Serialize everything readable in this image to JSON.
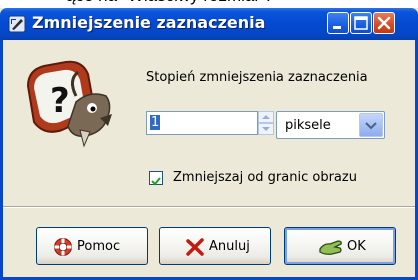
{
  "background_text": "ące na \"Właściwy rozmiar\".",
  "window": {
    "title": "Zmniejszenie zaznaczenia",
    "title_icon": "shrink-selection-icon"
  },
  "title_buttons": {
    "minimize": "minimize-icon",
    "maximize": "maximize-icon",
    "close": "close-icon"
  },
  "dialog": {
    "icon": "gimp-help-icon",
    "shrink_label": "Stopień zmniejszenia zaznaczenia",
    "shrink_value": "1",
    "unit": "piksele",
    "shrink_from_border_label": "Zmniejszaj od granic obrazu",
    "shrink_from_border_checked": true
  },
  "buttons": {
    "help": "Pomoc",
    "cancel": "Anuluj",
    "ok": "OK"
  },
  "colors": {
    "titlebar": "#0449d0",
    "dialog_bg": "#ece9d8",
    "selection": "#316ac5"
  }
}
